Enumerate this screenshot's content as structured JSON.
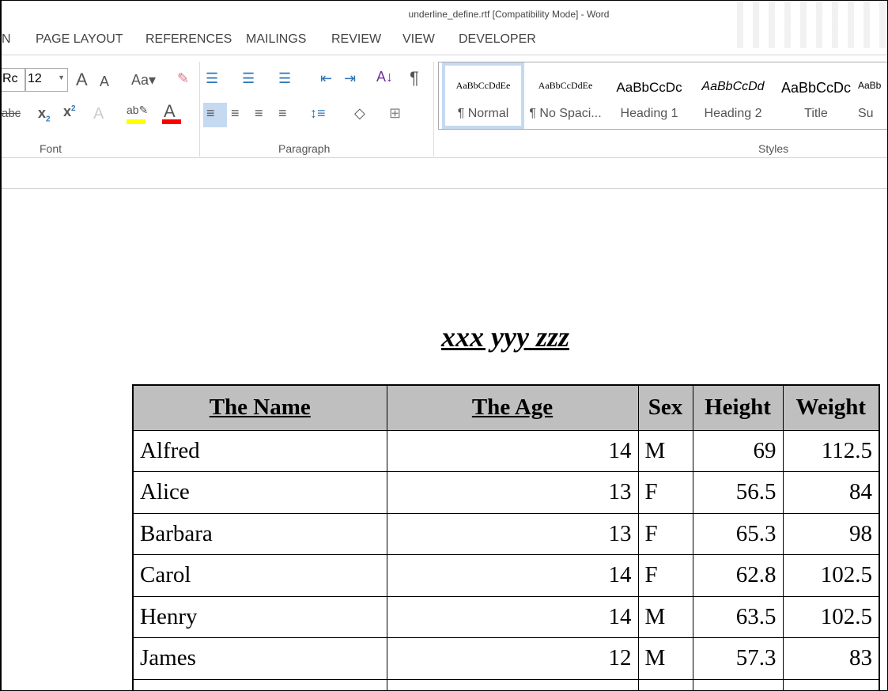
{
  "window": {
    "title": "underline_define.rtf [Compatibility Mode] - Word"
  },
  "tabs": [
    "N",
    "PAGE LAYOUT",
    "REFERENCES",
    "MAILINGS",
    "REVIEW",
    "VIEW",
    "DEVELOPER"
  ],
  "ribbon": {
    "font": {
      "name": "Rc",
      "size": "12",
      "label": "Font"
    },
    "paragraph": {
      "label": "Paragraph"
    },
    "styles": {
      "label": "Styles",
      "items": [
        {
          "preview": "AaBbCcDdEe",
          "name": "¶ Normal"
        },
        {
          "preview": "AaBbCcDdEe",
          "name": "¶ No Spaci..."
        },
        {
          "preview": "AaBbCcDc",
          "name": "Heading 1"
        },
        {
          "preview": "AaBbCcDd",
          "name": "Heading 2"
        },
        {
          "preview": "AaBbCcDc",
          "name": "Title"
        },
        {
          "preview": "AaBb",
          "name": "Su"
        }
      ]
    },
    "colors": {
      "highlight": "#ffff00",
      "font_color": "#ff0000",
      "selected": "#c5d9f1"
    }
  },
  "document": {
    "title": "xxx yyy zzz",
    "table": {
      "headers": [
        "The Name",
        "The Age",
        "Sex",
        "Height",
        "Weight"
      ],
      "rows": [
        [
          "Alfred",
          "14",
          "M",
          "69",
          "112.5"
        ],
        [
          "Alice",
          "13",
          "F",
          "56.5",
          "84"
        ],
        [
          "Barbara",
          "13",
          "F",
          "65.3",
          "98"
        ],
        [
          "Carol",
          "14",
          "F",
          "62.8",
          "102.5"
        ],
        [
          "Henry",
          "14",
          "M",
          "63.5",
          "102.5"
        ],
        [
          "James",
          "12",
          "M",
          "57.3",
          "83"
        ]
      ]
    }
  }
}
